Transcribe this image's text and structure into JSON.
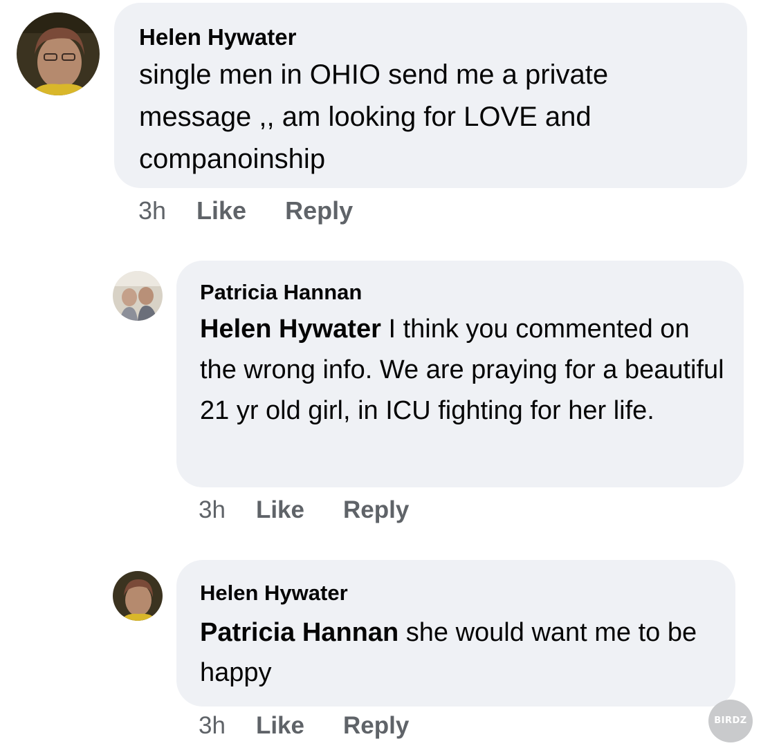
{
  "comments": [
    {
      "author": "Helen Hywater",
      "mention": "",
      "text": "single  men in OHIO send me  a private message ,, am looking for LOVE  and companoinship",
      "time": "3h",
      "like_label": "Like",
      "reply_label": "Reply",
      "avatar_icon": "profile-photo-icon"
    },
    {
      "author": "Patricia Hannan",
      "mention": "Helen Hywater",
      "text": " I think you commented on the wrong info. We are praying for a beautiful 21 yr old girl, in ICU fighting for her life.",
      "time": "3h",
      "like_label": "Like",
      "reply_label": "Reply",
      "avatar_icon": "profile-photo-icon"
    },
    {
      "author": "Helen Hywater",
      "mention": "Patricia Hannan",
      "text": " she   would want me to be happy",
      "time": "3h",
      "like_label": "Like",
      "reply_label": "Reply",
      "avatar_icon": "profile-photo-icon"
    }
  ],
  "watermark": {
    "label": "BIRDZ"
  },
  "colors": {
    "bubble_background": "#eff1f5",
    "action_text": "#5f6368",
    "body_text": "#050505"
  }
}
